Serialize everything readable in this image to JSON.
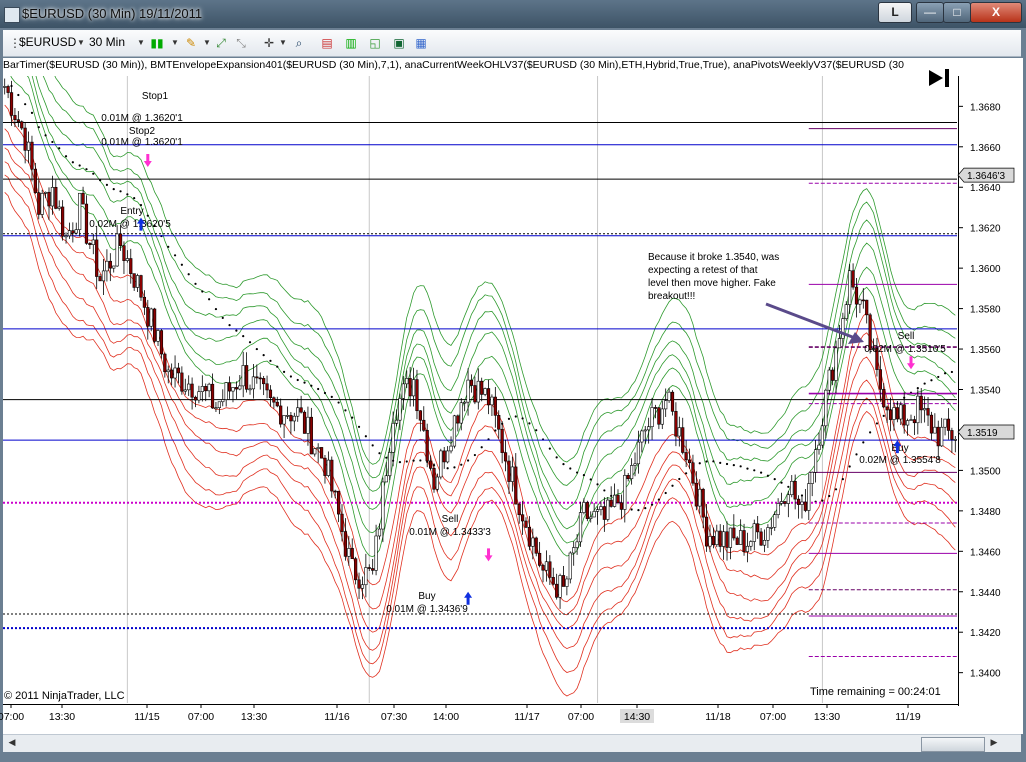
{
  "window": {
    "title": "$EURUSD (30 Min)  19/11/2011",
    "link_button": "L",
    "min_button": "—",
    "max_button": "□",
    "close_button": "X"
  },
  "toolbar": {
    "instrument": "$EURUSD",
    "interval": "30 Min"
  },
  "indicator_text": "BarTimer($EURUSD (30 Min)), BMTEnvelopeExpansion401($EURUSD (30 Min),7,1), anaCurrentWeekOHLV37($EURUSD (30 Min),ETH,Hybrid,True,True), anaPivotsWeeklyV37($EURUSD (30",
  "copyright": "© 2011 NinjaTrader, LLC",
  "time_remaining": "Time remaining = 00:24:01",
  "current_price_label": "1.3519",
  "marker_price_label": "1.3646'3",
  "annotation": {
    "lines": [
      "Because it broke 1.3540, was",
      "expecting a retest of that",
      "level then move higher. Fake",
      "breakout!!!"
    ]
  },
  "chart_data": {
    "type": "candlestick",
    "instrument": "$EURUSD",
    "interval": "30 Min",
    "y_range": [
      1.3385,
      1.3695
    ],
    "y_ticks": [
      1.368,
      1.366,
      1.364,
      1.362,
      1.36,
      1.358,
      1.356,
      1.354,
      1.352,
      1.35,
      1.348,
      1.346,
      1.344,
      1.342,
      1.34
    ],
    "y_tick_labels": [
      "1.3680",
      "1.3660",
      "1.3640",
      "1.3620",
      "1.3600",
      "1.3580",
      "1.3560",
      "1.3540",
      "1.3520",
      "1.3500",
      "1.3480",
      "1.3460",
      "1.3440",
      "1.3420",
      "1.3400"
    ],
    "x_tick_labels": [
      "07:00",
      "13:30",
      "11/15",
      "07:00",
      "13:30",
      "11/16",
      "07:30",
      "14:00",
      "11/17",
      "07:00",
      "14:30",
      "11/18",
      "07:00",
      "13:30",
      "11/19"
    ],
    "close_path": [
      [
        0,
        1.369
      ],
      [
        6,
        1.3665
      ],
      [
        10,
        1.363
      ],
      [
        14,
        1.364
      ],
      [
        18,
        1.3615
      ],
      [
        22,
        1.363
      ],
      [
        28,
        1.3595
      ],
      [
        34,
        1.3612
      ],
      [
        40,
        1.3588
      ],
      [
        48,
        1.3548
      ],
      [
        56,
        1.3542
      ],
      [
        62,
        1.3532
      ],
      [
        70,
        1.3548
      ],
      [
        78,
        1.3532
      ],
      [
        86,
        1.3528
      ],
      [
        94,
        1.3504
      ],
      [
        102,
        1.345
      ],
      [
        108,
        1.3448
      ],
      [
        114,
        1.353
      ],
      [
        120,
        1.3545
      ],
      [
        126,
        1.3495
      ],
      [
        132,
        1.3525
      ],
      [
        136,
        1.3545
      ],
      [
        142,
        1.3535
      ],
      [
        150,
        1.349
      ],
      [
        158,
        1.345
      ],
      [
        164,
        1.344
      ],
      [
        170,
        1.3478
      ],
      [
        176,
        1.3475
      ],
      [
        182,
        1.349
      ],
      [
        188,
        1.352
      ],
      [
        194,
        1.3535
      ],
      [
        200,
        1.351
      ],
      [
        206,
        1.347
      ],
      [
        212,
        1.3465
      ],
      [
        218,
        1.3465
      ],
      [
        224,
        1.3472
      ],
      [
        230,
        1.3495
      ],
      [
        234,
        1.3478
      ],
      [
        238,
        1.3512
      ],
      [
        244,
        1.356
      ],
      [
        248,
        1.3595
      ],
      [
        252,
        1.3578
      ],
      [
        256,
        1.3545
      ],
      [
        262,
        1.3524
      ],
      [
        268,
        1.353
      ],
      [
        274,
        1.3518
      ]
    ],
    "horizontal_levels": [
      {
        "price": 1.3672,
        "color": "#000000",
        "style": "solid"
      },
      {
        "price": 1.3661,
        "color": "#0000cc",
        "style": "solid"
      },
      {
        "price": 1.3644,
        "color": "#000000",
        "style": "solid"
      },
      {
        "price": 1.3617,
        "color": "#000000",
        "style": "dashed"
      },
      {
        "price": 1.3616,
        "color": "#0000cc",
        "style": "solid"
      },
      {
        "price": 1.357,
        "color": "#0000cc",
        "style": "solid"
      },
      {
        "price": 1.3535,
        "color": "#000000",
        "style": "solid"
      },
      {
        "price": 1.3515,
        "color": "#0000cc",
        "style": "solid"
      },
      {
        "price": 1.3484,
        "color": "#cc00cc",
        "style": "dotted"
      },
      {
        "price": 1.3429,
        "color": "#000000",
        "style": "dashed"
      },
      {
        "price": 1.3422,
        "color": "#0000cc",
        "style": "dotted"
      }
    ],
    "weekly_pivots": [
      1.3669,
      1.3642,
      1.3592,
      1.3561,
      1.3538,
      1.3533,
      1.3499,
      1.3474,
      1.3459,
      1.3441,
      1.3428,
      1.3408
    ],
    "trades": [
      {
        "text1": "Stop1",
        "text2": "0.01M @ 1.3620'1"
      },
      {
        "text1": "Stop2",
        "text2": "0.01M @ 1.3620'1"
      },
      {
        "text1": "Entry",
        "text2": "0.02M @ 1.3620'5"
      },
      {
        "text1": "Sell",
        "text2": "0.01M @ 1.3433'3"
      },
      {
        "text1": "Buy",
        "text2": "0.01M @ 1.3436'9"
      },
      {
        "text1": "Sell",
        "text2": "0.02M @ 1.3510'5"
      },
      {
        "text1": "Buy",
        "text2": "0.02M @ 1.3554'8"
      }
    ]
  }
}
